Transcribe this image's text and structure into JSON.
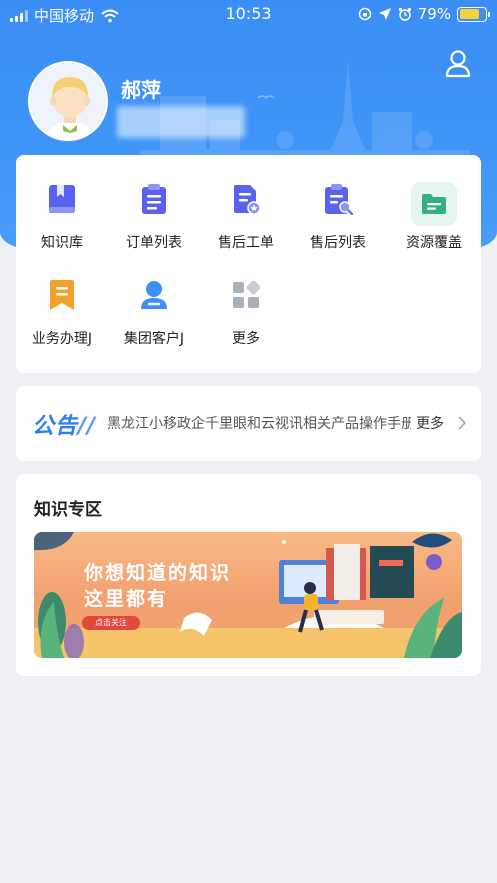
{
  "status_bar": {
    "carrier": "中国移动",
    "time": "10:53",
    "battery": "79%",
    "battery_level": 0.79
  },
  "profile": {
    "name": "郝萍"
  },
  "menu": {
    "items": [
      {
        "label": "知识库",
        "icon": "book-icon"
      },
      {
        "label": "订单列表",
        "icon": "clipboard-list-icon"
      },
      {
        "label": "售后工单",
        "icon": "document-star-icon"
      },
      {
        "label": "售后列表",
        "icon": "clipboard-search-icon"
      },
      {
        "label": "资源覆盖",
        "icon": "folder-icon"
      },
      {
        "label": "业务办理J",
        "icon": "bookmark-icon"
      },
      {
        "label": "集团客户J",
        "icon": "customer-icon"
      },
      {
        "label": "更多",
        "icon": "grid-more-icon"
      }
    ]
  },
  "notice": {
    "logo": "公告",
    "text": "黑龙江小移政企千里眼和云视讯相关产品操作手册",
    "more": "更多"
  },
  "knowledge_zone": {
    "title": "知识专区",
    "banner": {
      "line1": "你想知道的知识",
      "line2": "这里都有",
      "button": "点击关注"
    }
  },
  "colors": {
    "brand_blue": "#3b8ef5",
    "icon_blue": "#5463f2",
    "icon_green": "#34b07f",
    "icon_orange": "#f3a12d"
  }
}
